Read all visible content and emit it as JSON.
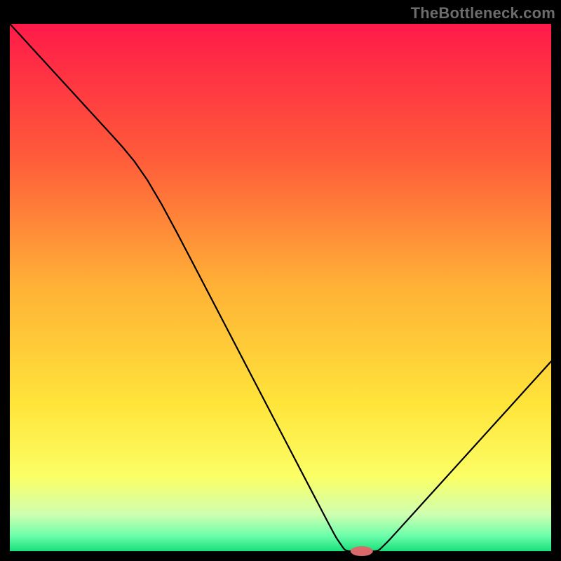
{
  "watermark": "TheBottleneck.com",
  "chart_data": {
    "type": "line",
    "title": "",
    "xlabel": "",
    "ylabel": "",
    "xlim": [
      0,
      100
    ],
    "ylim": [
      0,
      100
    ],
    "x": [
      0,
      25,
      60,
      62,
      68,
      70,
      100
    ],
    "values": [
      100,
      72,
      3,
      0,
      0,
      2,
      36
    ],
    "marker": {
      "x": 65,
      "y": 0
    },
    "background_gradient": {
      "type": "vertical",
      "stops": [
        {
          "pos": 0.0,
          "color": "#ff1a49"
        },
        {
          "pos": 0.25,
          "color": "#ff5a3a"
        },
        {
          "pos": 0.5,
          "color": "#ffb236"
        },
        {
          "pos": 0.72,
          "color": "#ffe43a"
        },
        {
          "pos": 0.86,
          "color": "#fbff66"
        },
        {
          "pos": 0.93,
          "color": "#cfffb0"
        },
        {
          "pos": 0.97,
          "color": "#6fffac"
        },
        {
          "pos": 1.0,
          "color": "#18e07a"
        }
      ]
    }
  }
}
